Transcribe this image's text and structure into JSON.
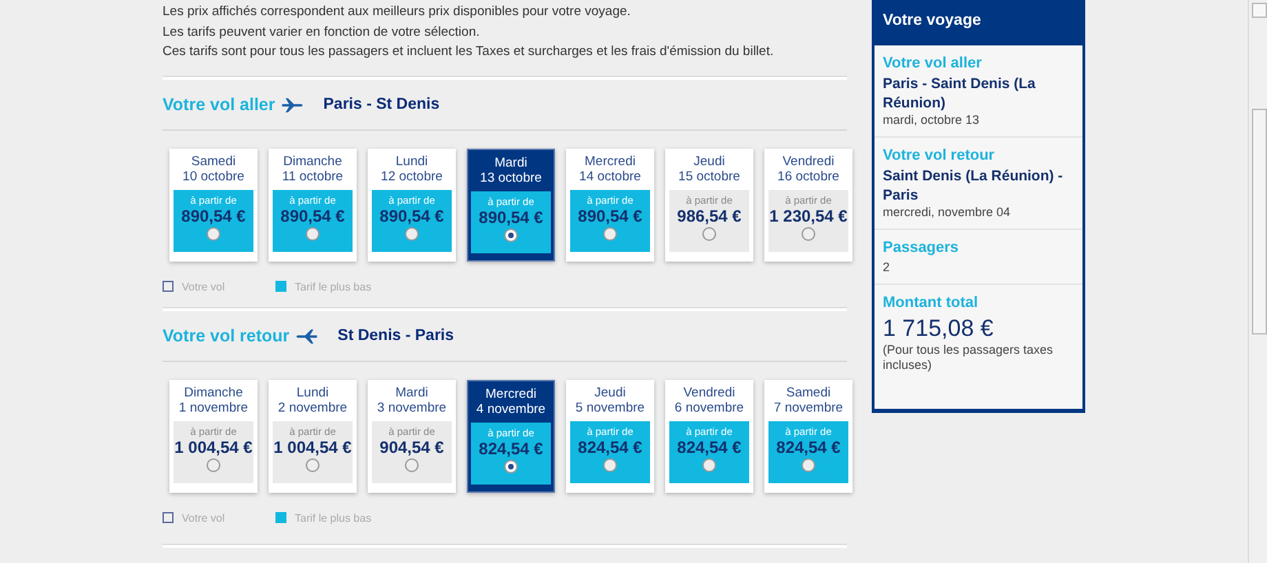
{
  "intro": [
    "Les prix affichés correspondent aux meilleurs prix disponibles pour votre voyage.",
    "Les tarifs peuvent varier en fonction de votre sélection.",
    "Ces tarifs sont pour tous les passagers et incluent les Taxes et surcharges et les frais d'émission du billet."
  ],
  "flights": [
    {
      "title": "Votre vol aller",
      "kind": "outbound",
      "route": "Paris - St Denis",
      "days": [
        {
          "day": "Samedi",
          "date": "10 octobre",
          "from": "à partir de",
          "price": "890,54 €",
          "kind": "lowest",
          "selected": false
        },
        {
          "day": "Dimanche",
          "date": "11 octobre",
          "from": "à partir de",
          "price": "890,54 €",
          "kind": "lowest",
          "selected": false
        },
        {
          "day": "Lundi",
          "date": "12 octobre",
          "from": "à partir de",
          "price": "890,54 €",
          "kind": "lowest",
          "selected": false
        },
        {
          "day": "Mardi",
          "date": "13 octobre",
          "from": "à partir de",
          "price": "890,54 €",
          "kind": "lowest",
          "selected": true
        },
        {
          "day": "Mercredi",
          "date": "14 octobre",
          "from": "à partir de",
          "price": "890,54 €",
          "kind": "lowest",
          "selected": false
        },
        {
          "day": "Jeudi",
          "date": "15 octobre",
          "from": "à partir de",
          "price": "986,54 €",
          "kind": "regular",
          "selected": false
        },
        {
          "day": "Vendredi",
          "date": "16 octobre",
          "from": "à partir de",
          "price": "1 230,54 €",
          "kind": "regular",
          "selected": false
        }
      ],
      "legend": [
        "Votre vol",
        "Tarif le plus bas"
      ]
    },
    {
      "title": "Votre vol retour",
      "kind": "return",
      "route": "St Denis - Paris",
      "days": [
        {
          "day": "Dimanche",
          "date": "1 novembre",
          "from": "à partir de",
          "price": "1 004,54 €",
          "kind": "regular",
          "selected": false
        },
        {
          "day": "Lundi",
          "date": "2 novembre",
          "from": "à partir de",
          "price": "1 004,54 €",
          "kind": "regular",
          "selected": false
        },
        {
          "day": "Mardi",
          "date": "3 novembre",
          "from": "à partir de",
          "price": "904,54 €",
          "kind": "regular",
          "selected": false
        },
        {
          "day": "Mercredi",
          "date": "4 novembre",
          "from": "à partir de",
          "price": "824,54 €",
          "kind": "lowest",
          "selected": true
        },
        {
          "day": "Jeudi",
          "date": "5 novembre",
          "from": "à partir de",
          "price": "824,54 €",
          "kind": "lowest",
          "selected": false
        },
        {
          "day": "Vendredi",
          "date": "6 novembre",
          "from": "à partir de",
          "price": "824,54 €",
          "kind": "lowest",
          "selected": false
        },
        {
          "day": "Samedi",
          "date": "7 novembre",
          "from": "à partir de",
          "price": "824,54 €",
          "kind": "lowest",
          "selected": false
        }
      ],
      "legend": [
        "Votre vol",
        "Tarif le plus bas"
      ]
    }
  ],
  "summary": {
    "title": "Votre voyage",
    "sections": [
      {
        "heading": "Votre vol aller",
        "route": "Paris - Saint Denis (La Réunion)",
        "detail": "mardi, octobre 13"
      },
      {
        "heading": "Votre vol retour",
        "route": "Saint Denis (La Réunion) - Paris",
        "detail": "mercredi, novembre 04"
      },
      {
        "heading": "Passagers",
        "detail": "2"
      },
      {
        "heading": "Montant total",
        "amount": "1 715,08 €",
        "detail": "(Pour tous les passagers taxes incluses)"
      }
    ]
  }
}
